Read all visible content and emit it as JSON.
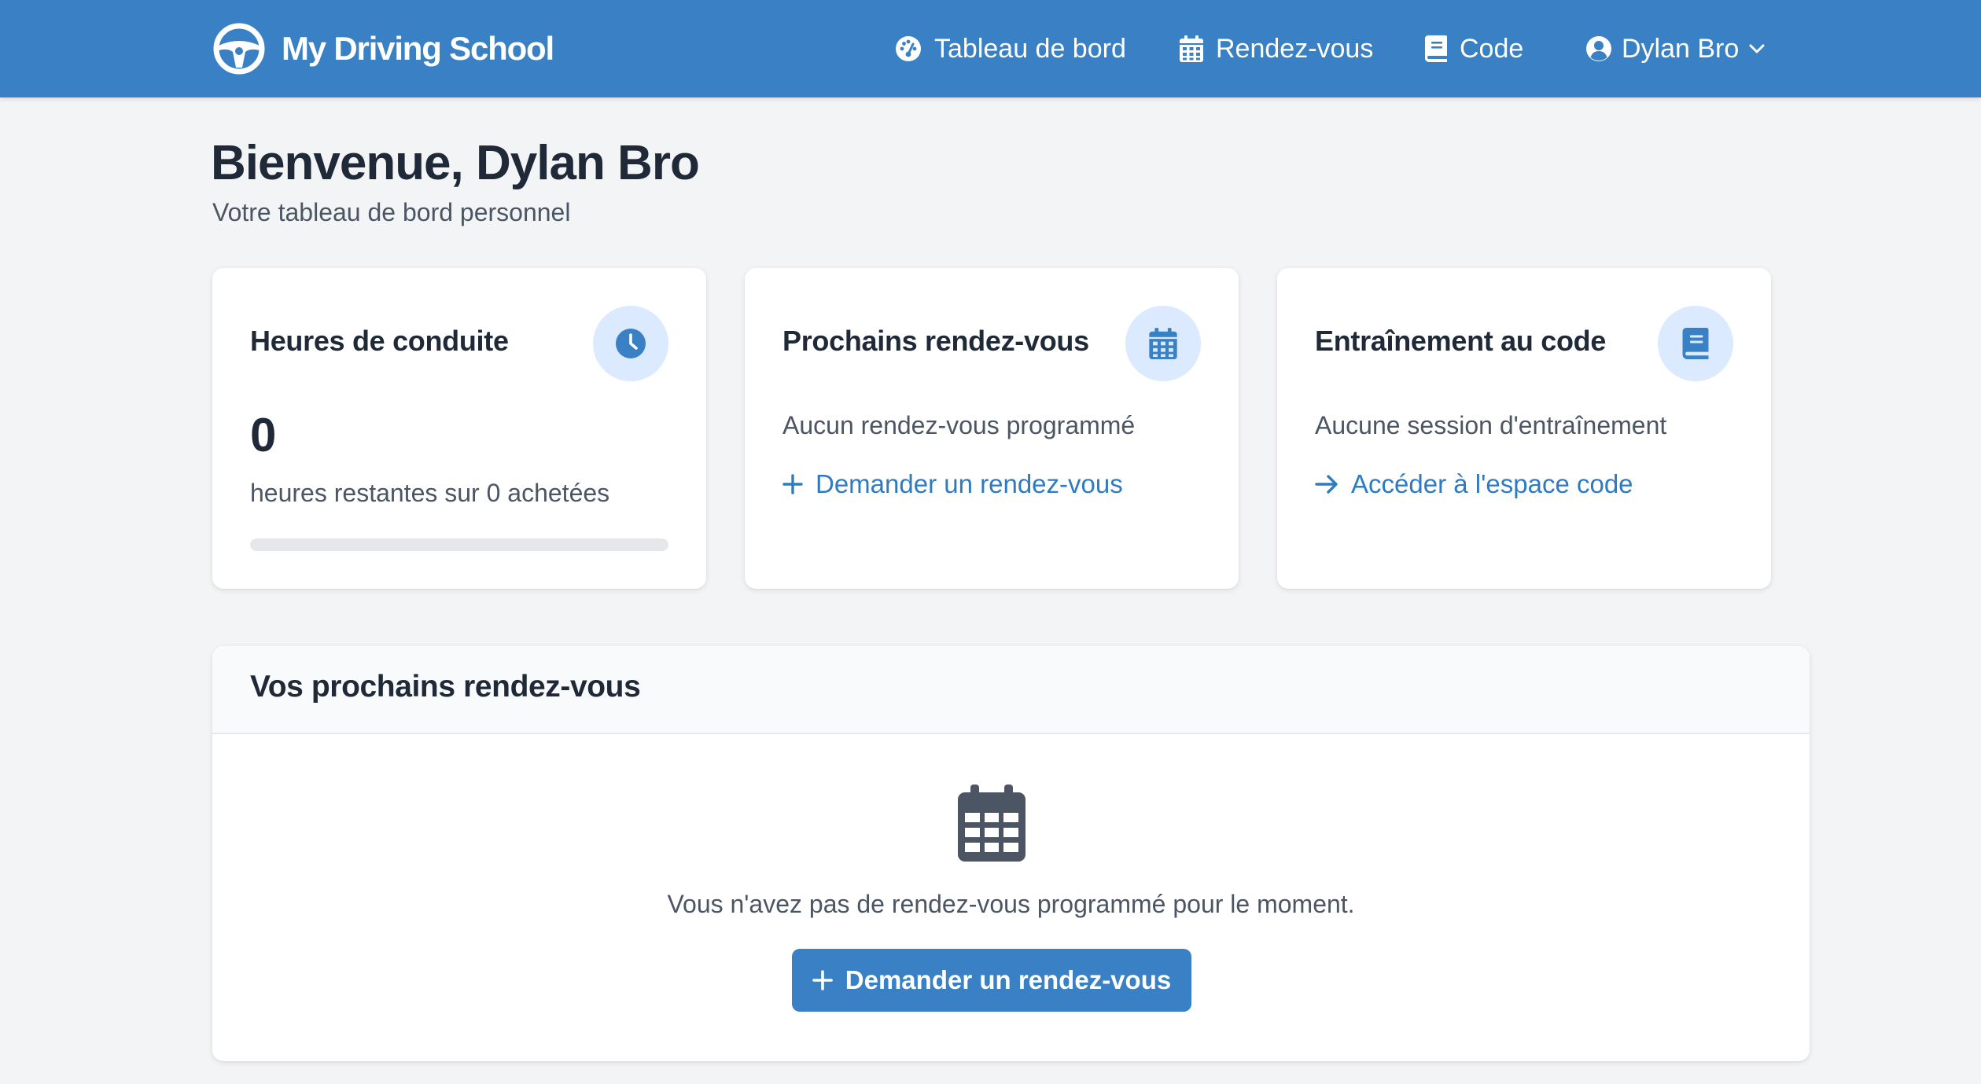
{
  "nav": {
    "brand": "My Driving School",
    "items": [
      {
        "label": "Tableau de bord",
        "icon": "gauge-icon"
      },
      {
        "label": "Rendez-vous",
        "icon": "calendar-icon"
      },
      {
        "label": "Code",
        "icon": "book-icon"
      }
    ],
    "user": {
      "name": "Dylan Bro",
      "icon": "user-circle-icon",
      "caret": "chevron-down-icon"
    }
  },
  "header": {
    "title": "Bienvenue, Dylan Bro",
    "subtitle": "Votre tableau de bord personnel"
  },
  "cards": {
    "hours": {
      "title": "Heures de conduite",
      "icon": "clock-icon",
      "value": "0",
      "caption": "heures restantes sur 0 achetées",
      "progress_fraction": 0
    },
    "appointments": {
      "title": "Prochains rendez-vous",
      "icon": "calendar-icon",
      "text": "Aucun rendez-vous programmé",
      "link": "Demander un rendez-vous",
      "link_icon": "plus-icon"
    },
    "code": {
      "title": "Entraînement au code",
      "icon": "book-icon",
      "text": "Aucune session d'entraînement",
      "link": "Accéder à l'espace code",
      "link_icon": "arrow-right-icon"
    }
  },
  "panel": {
    "title": "Vos prochains rendez-vous",
    "empty_icon": "calendar-icon",
    "empty_text": "Vous n'avez pas de rendez-vous programmé pour le moment.",
    "button": "Demander un rendez-vous",
    "button_icon": "plus-icon"
  },
  "colors": {
    "primary": "#3a80c4",
    "link": "#2f7bc2",
    "icon_bg": "#dbeafe",
    "page_bg": "#f3f4f6"
  }
}
